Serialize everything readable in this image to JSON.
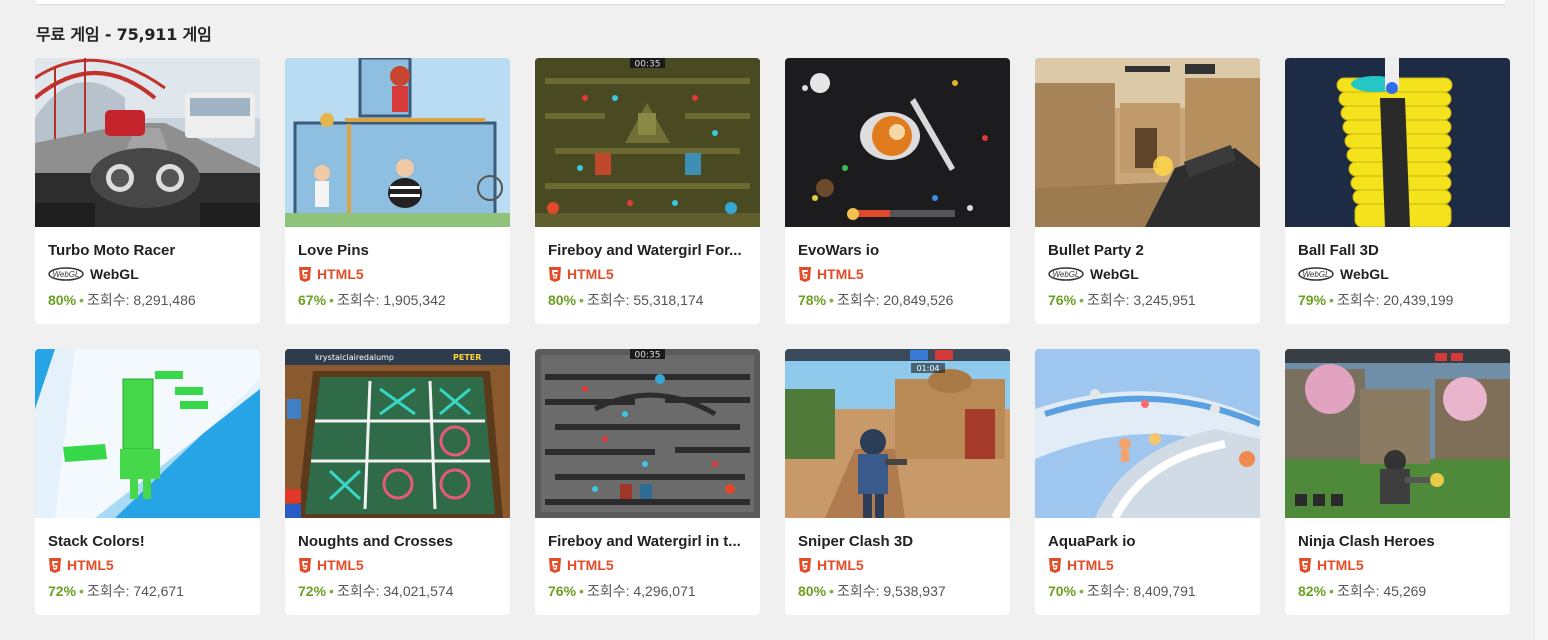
{
  "section": {
    "title": "무료 게임 - 75,911 게임"
  },
  "views_label": "조회수:",
  "games": [
    {
      "name": "Turbo Moto Racer",
      "platform": "WebGL",
      "rating": "80%",
      "views": "8,291,486"
    },
    {
      "name": "Love Pins",
      "platform": "HTML5",
      "rating": "67%",
      "views": "1,905,342"
    },
    {
      "name": "Fireboy and Watergirl For...",
      "platform": "HTML5",
      "rating": "80%",
      "views": "55,318,174"
    },
    {
      "name": "EvoWars io",
      "platform": "HTML5",
      "rating": "78%",
      "views": "20,849,526"
    },
    {
      "name": "Bullet Party 2",
      "platform": "WebGL",
      "rating": "76%",
      "views": "3,245,951"
    },
    {
      "name": "Ball Fall 3D",
      "platform": "WebGL",
      "rating": "79%",
      "views": "20,439,199"
    },
    {
      "name": "Stack Colors!",
      "platform": "HTML5",
      "rating": "72%",
      "views": "742,671"
    },
    {
      "name": "Noughts and Crosses",
      "platform": "HTML5",
      "rating": "72%",
      "views": "34,021,574"
    },
    {
      "name": "Fireboy and Watergirl in t...",
      "platform": "HTML5",
      "rating": "76%",
      "views": "4,296,071"
    },
    {
      "name": "Sniper Clash 3D",
      "platform": "HTML5",
      "rating": "80%",
      "views": "9,538,937"
    },
    {
      "name": "AquaPark io",
      "platform": "HTML5",
      "rating": "70%",
      "views": "8,409,791"
    },
    {
      "name": "Ninja Clash Heroes",
      "platform": "HTML5",
      "rating": "82%",
      "views": "45,269"
    }
  ],
  "thumb_texts": {
    "fireboy_timer_1": "00:35",
    "fireboy_timer_2": "00:35",
    "noughts_player": "krystalclairedalump",
    "noughts_opponent": "PETER",
    "sniper_timer": "01:04"
  },
  "icons": {
    "html5": "html5-shield-icon",
    "webgl": "webgl-logo-icon"
  },
  "colors": {
    "rating_green": "#6aa121",
    "html5_orange": "#e34c26",
    "background": "#f0f0f0"
  }
}
